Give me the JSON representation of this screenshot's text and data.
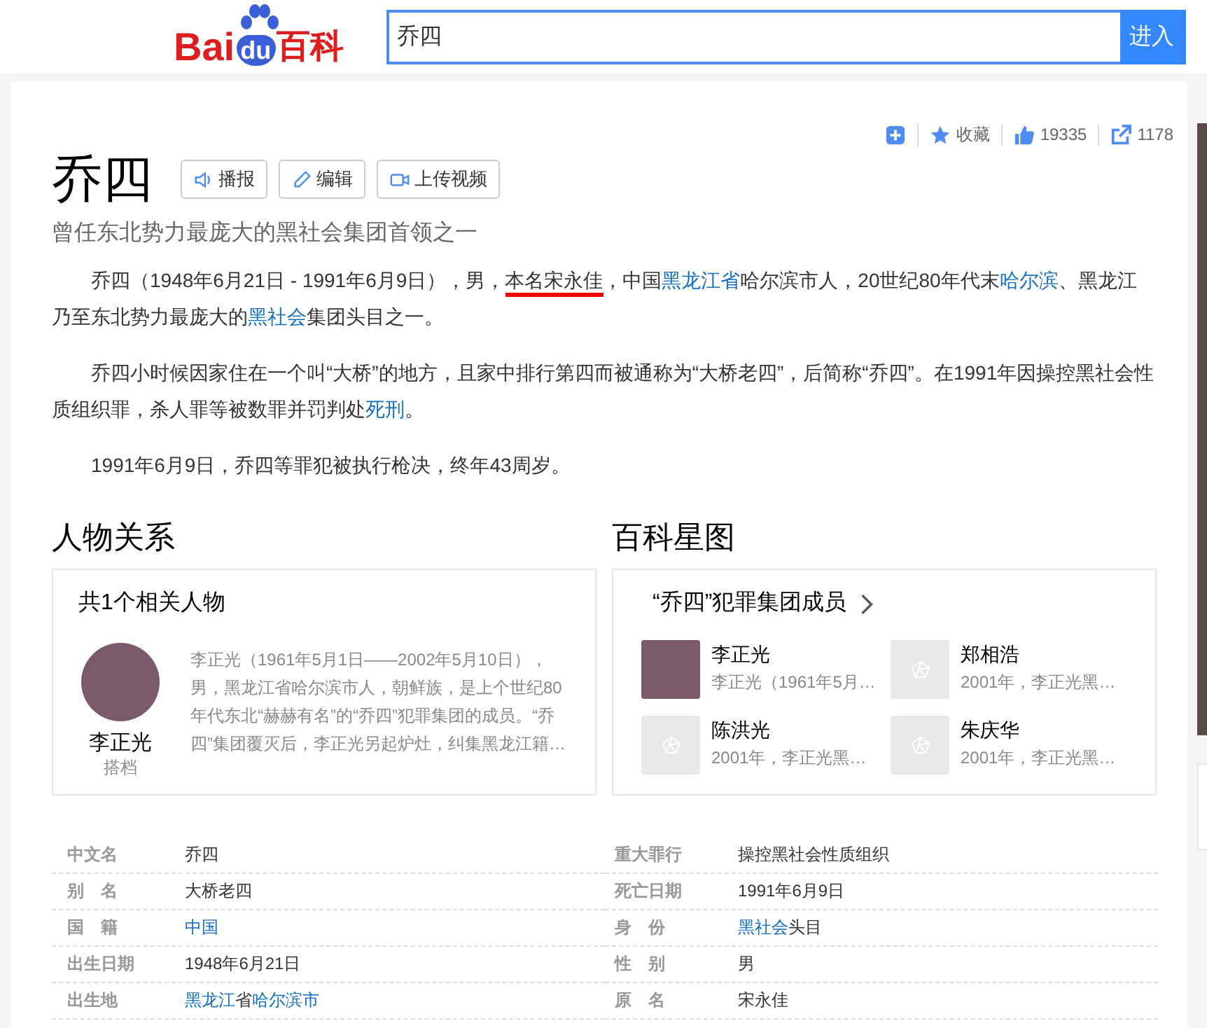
{
  "header": {
    "logo": [
      "Bai",
      "du",
      "百科"
    ],
    "search": {
      "value": "乔四"
    },
    "search_button": "进入"
  },
  "toolbar": {
    "favorite": "收藏",
    "likes": "19335",
    "shares": "1178"
  },
  "title": "乔四",
  "title_buttons": [
    {
      "kind": "audio",
      "label": "播报"
    },
    {
      "kind": "edit",
      "label": "编辑"
    },
    {
      "kind": "video",
      "label": "上传视频"
    }
  ],
  "subtitle": "曾任东北势力最庞大的黑社会集团首领之一",
  "paragraphs": [
    [
      {
        "kind": "plain",
        "text": "乔四（1948年6月21日 - 1991年6月9日），男，"
      },
      {
        "kind": "marked",
        "text": "本名宋永佳"
      },
      {
        "kind": "plain",
        "text": "，中国"
      },
      {
        "kind": "link",
        "text": "黑龙江省"
      },
      {
        "kind": "plain",
        "text": "哈尔滨市人，20世纪80年代末"
      },
      {
        "kind": "link",
        "text": "哈尔滨"
      },
      {
        "kind": "plain",
        "text": "、黑龙江乃至东北势力最庞大的"
      },
      {
        "kind": "link",
        "text": "黑社会"
      },
      {
        "kind": "plain",
        "text": "集团头目之一。"
      }
    ],
    [
      {
        "kind": "plain",
        "text": "乔四小时候因家住在一个叫“大桥”的地方，且家中排行第四而被通称为“大桥老四”，后简称“乔四”。在1991年因操控黑社会性质组织罪，杀人罪等被数罪并罚判处"
      },
      {
        "kind": "link",
        "text": "死刑"
      },
      {
        "kind": "plain",
        "text": "。"
      }
    ],
    [
      {
        "kind": "plain",
        "text": "1991年6月9日，乔四等罪犯被执行枪决，终年43周岁。"
      }
    ]
  ],
  "relations": {
    "heading": "人物关系",
    "count": "共1个相关人物",
    "person": {
      "name": "李正光",
      "role": "搭档",
      "summary": "李正光（1961年5月1日——2002年5月10日），男，黑龙江省哈尔滨市人，朝鲜族，是上个世纪80年代东北“赫赫有名”的“乔四”犯罪集团的成员。“乔四”集团覆灭后，李正光另起炉灶，纠集黑龙江籍…"
    }
  },
  "star_map": {
    "heading": "百科星图",
    "group": "“乔四”犯罪集团成员",
    "members": [
      {
        "name": "李正光",
        "summary": "李正光（1961年5月…",
        "kind": "photo"
      },
      {
        "name": "郑相浩",
        "summary": "2001年，李正光黑…",
        "kind": "placeholder"
      },
      {
        "name": "陈洪光",
        "summary": "2001年，李正光黑…",
        "kind": "placeholder"
      },
      {
        "name": "朱庆华",
        "summary": "2001年，李正光黑…",
        "kind": "placeholder"
      }
    ]
  },
  "basic_info": [
    [
      {
        "label": "中文名",
        "value": [
          {
            "kind": "plain",
            "text": "乔四"
          }
        ]
      },
      {
        "label": "重大罪行",
        "value": [
          {
            "kind": "plain",
            "text": "操控黑社会性质组织"
          }
        ]
      }
    ],
    [
      {
        "label": "别　名",
        "value": [
          {
            "kind": "plain",
            "text": "大桥老四"
          }
        ]
      },
      {
        "label": "死亡日期",
        "value": [
          {
            "kind": "plain",
            "text": "1991年6月9日"
          }
        ]
      }
    ],
    [
      {
        "label": "国　籍",
        "value": [
          {
            "kind": "link",
            "text": "中国"
          }
        ]
      },
      {
        "label": "身　份",
        "value": [
          {
            "kind": "link",
            "text": "黑社会"
          },
          {
            "kind": "plain",
            "text": "头目"
          }
        ]
      }
    ],
    [
      {
        "label": "出生日期",
        "value": [
          {
            "kind": "plain",
            "text": "1948年6月21日"
          }
        ]
      },
      {
        "label": "性　别",
        "value": [
          {
            "kind": "plain",
            "text": "男"
          }
        ]
      }
    ],
    [
      {
        "label": "出生地",
        "value": [
          {
            "kind": "link",
            "text": "黑龙江"
          },
          {
            "kind": "plain",
            "text": "省"
          },
          {
            "kind": "link",
            "text": "哈尔滨市"
          }
        ]
      },
      {
        "label": "原　名",
        "value": [
          {
            "kind": "plain",
            "text": "宋永佳"
          }
        ]
      }
    ]
  ]
}
